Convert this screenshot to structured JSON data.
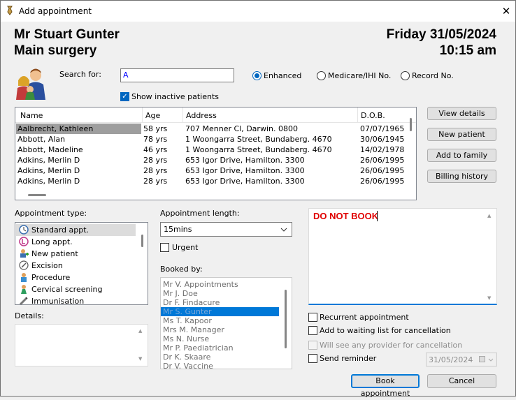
{
  "window": {
    "title": "Add appointment"
  },
  "header": {
    "doctor": "Mr Stuart Gunter",
    "location": "Main surgery",
    "date": "Friday 31/05/2024",
    "time": "10:15 am"
  },
  "search": {
    "label": "Search for:",
    "value": "A",
    "show_inactive": "Show inactive patients",
    "modes": [
      "Enhanced",
      "Medicare/IHI No.",
      "Record No."
    ]
  },
  "patients": {
    "columns": [
      "Name",
      "Age",
      "Address",
      "D.O.B."
    ],
    "rows": [
      [
        "Aalbrecht, Kathleen",
        "58 yrs",
        "707 Menner Cl, Darwin. 0800",
        "07/07/1965"
      ],
      [
        "Abbott, Alan",
        "78 yrs",
        "1 Woongarra Street, Bundaberg. 4670",
        "30/06/1945"
      ],
      [
        "Abbott, Madeline",
        "46 yrs",
        "1 Woongarra Street, Bundaberg. 4670",
        "14/02/1978"
      ],
      [
        "Adkins, Merlin D",
        "28 yrs",
        "653 Igor Drive, Hamilton. 3300",
        "26/06/1995"
      ],
      [
        "Adkins, Merlin D",
        "28 yrs",
        "653 Igor Drive, Hamilton. 3300",
        "26/06/1995"
      ],
      [
        "Adkins, Merlin D",
        "28 yrs",
        "653 Igor Drive, Hamilton. 3300",
        "26/06/1995"
      ]
    ]
  },
  "side_buttons": [
    "View details",
    "New patient",
    "Add to family",
    "Billing history"
  ],
  "appt_type": {
    "label": "Appointment type:",
    "items": [
      {
        "label": "Standard appt.",
        "icon": "clock-icon"
      },
      {
        "label": "Long appt.",
        "icon": "long-clock-icon"
      },
      {
        "label": "New patient",
        "icon": "new-patient-icon"
      },
      {
        "label": "Excision",
        "icon": "excision-icon"
      },
      {
        "label": "Procedure",
        "icon": "procedure-icon"
      },
      {
        "label": "Cervical screening",
        "icon": "cervical-icon"
      },
      {
        "label": "Immunisation",
        "icon": "syringe-icon"
      }
    ]
  },
  "details": {
    "label": "Details:"
  },
  "length": {
    "label": "Appointment length:",
    "value": "15mins",
    "urgent": "Urgent"
  },
  "booked_by": {
    "label": "Booked by:",
    "items": [
      "Mr V. Appointments",
      "Mr J. Doe",
      "Dr F. Findacure",
      "Mr S. Gunter",
      "Ms T. Kapoor",
      "Mrs M. Manager",
      "Ms N. Nurse",
      "Mr P. Paediatrician",
      "Dr K. Skaare",
      "Dr V. Vaccine"
    ]
  },
  "notes": {
    "text": "DO NOT BOOK",
    "color": "#e00000"
  },
  "options": {
    "recurrent": "Recurrent appointment",
    "waiting": "Add to waiting list for cancellation",
    "any_provider": "Will see any provider for cancellation",
    "reminder": "Send reminder",
    "reminder_date": "31/05/2024"
  },
  "actions": {
    "book": "Book appointment",
    "cancel": "Cancel"
  },
  "colors": {
    "accent": "#0078d7",
    "selection": "#0078d7",
    "grey_selection": "#9e9e9e"
  }
}
